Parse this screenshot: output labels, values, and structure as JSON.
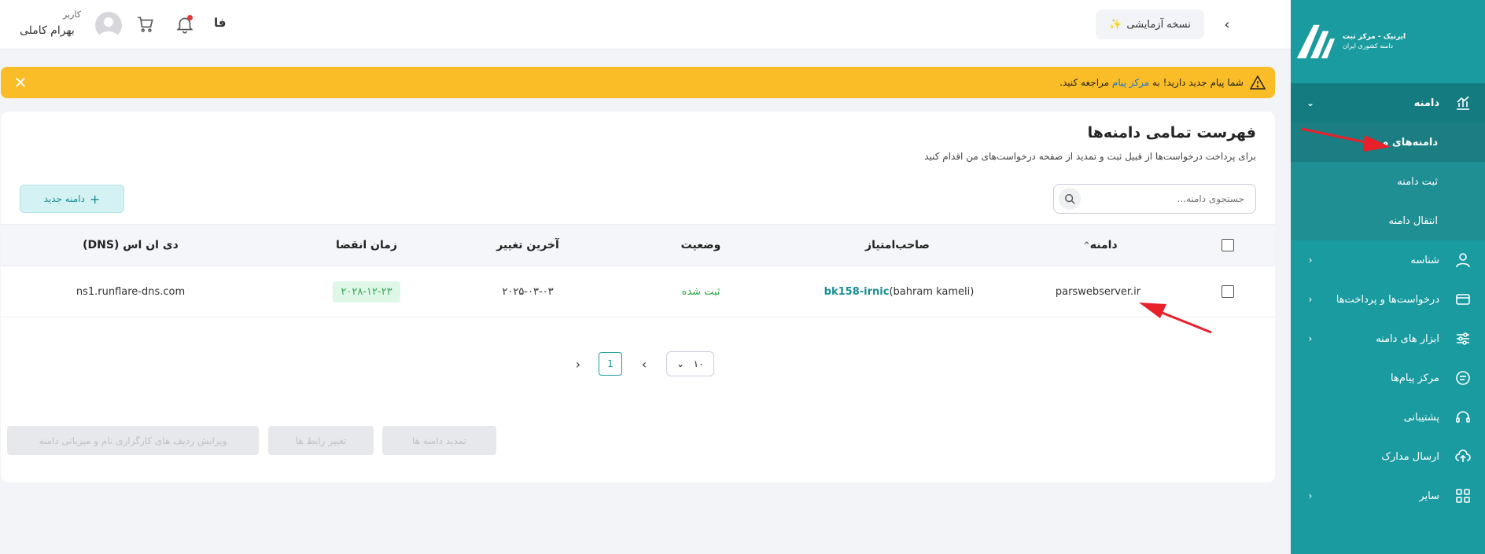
{
  "brand": {
    "line1": "ایرنیک - مرکز ثبت",
    "line2": "دامنه کشوری ایران"
  },
  "sidebar": {
    "items": [
      {
        "label": "دامنه",
        "icon": "chart-icon"
      },
      {
        "label": "شناسه",
        "icon": "user-icon"
      },
      {
        "label": "درخواست‌ها و پرداخت‌ها",
        "icon": "card-icon"
      },
      {
        "label": "ابزار های دامنه",
        "icon": "sliders-icon"
      },
      {
        "label": "مرکز پیام‌ها",
        "icon": "message-icon"
      },
      {
        "label": "پشتیبانی",
        "icon": "headset-icon"
      },
      {
        "label": "ارسال مدارک",
        "icon": "upload-icon"
      },
      {
        "label": "سایر",
        "icon": "grid-icon"
      }
    ],
    "sub_items": [
      {
        "label": "دامنه‌های من"
      },
      {
        "label": "ثبت دامنه"
      },
      {
        "label": "انتقال دامنه"
      }
    ]
  },
  "topbar": {
    "trial_label": "نسخه آزمایشی",
    "lang_label": "فا",
    "user_role": "کاربر",
    "user_name": "بهرام کاملی"
  },
  "banner": {
    "text_before": "شما پیام جدید دارید! به",
    "link_text": "مرکز پیام",
    "text_after": "مراجعه کنید."
  },
  "page": {
    "title": "فهرست تمامی دامنه‌ها",
    "subtitle": "برای پرداخت درخواست‌ها از قبیل ثبت و تمدید از صفحه درخواست‌های من اقدام کنید",
    "search_placeholder": "جستجوی دامنه...",
    "new_domain_label": "دامنه جدید"
  },
  "table": {
    "headers": {
      "domain": "دامنه",
      "owner": "صاحب‌امتیاز",
      "status": "وضعیت",
      "last_change": "آخرین تغییر",
      "expiry": "زمان انقضا",
      "dns": "دی ان اس (DNS)"
    },
    "rows": [
      {
        "domain": "parswebserver.ir",
        "owner_name": "(bahram kameli)",
        "owner_id": "bk158-irnic",
        "status": "ثبت شده",
        "last_change": "۲۰۲۵-۰۳-۰۳",
        "expiry": "۲۰۲۸-۱۲-۲۳",
        "dns": "ns1.runflare-dns.com"
      }
    ]
  },
  "pagination": {
    "page_size": "۱۰",
    "current_page": "1"
  },
  "actions": {
    "renew": "تمدید دامنه ها",
    "change_contact": "تغییر رابط ها",
    "edit_dns": "ویرایش ردیف های کارگزاری نام و میزبانی دامنه"
  },
  "colors": {
    "primary": "#1a9ba0",
    "banner": "#fbbd27",
    "status_ok": "#27a844",
    "annotation_arrow": "#e8202a"
  }
}
